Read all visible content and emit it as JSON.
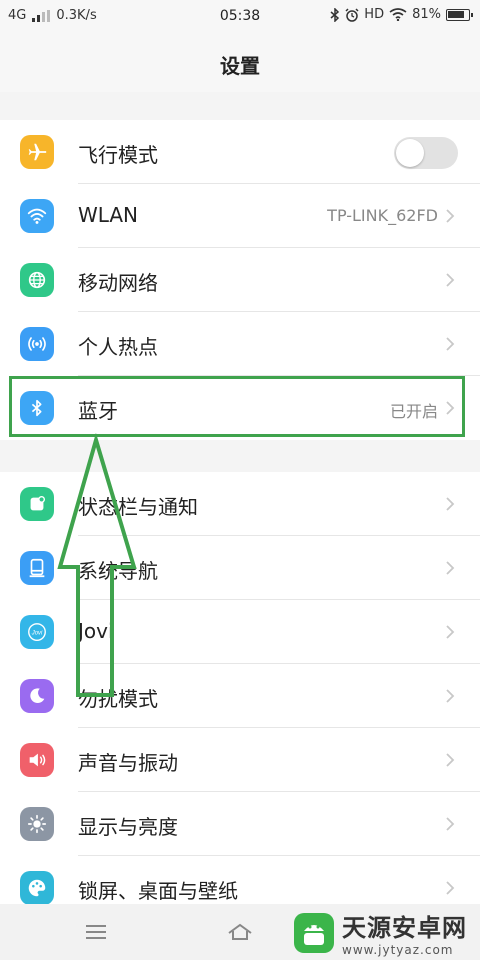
{
  "status_bar": {
    "network": "4G",
    "speed": "0.3K/s",
    "time": "05:38",
    "hd": "HD",
    "battery": "81%",
    "battery_level": 0.81
  },
  "header": {
    "title": "设置"
  },
  "group1": [
    {
      "label": "飞行模式",
      "icon": "airplane-icon",
      "color": "#f7b52a",
      "toggle": false
    },
    {
      "label": "WLAN",
      "value": "TP-LINK_62FD",
      "icon": "wifi-icon",
      "color": "#3da6f5"
    },
    {
      "label": "移动网络",
      "icon": "globe-icon",
      "color": "#2fc889"
    },
    {
      "label": "个人热点",
      "icon": "hotspot-icon",
      "color": "#3b9ef5"
    },
    {
      "label": "蓝牙",
      "value": "已开启",
      "icon": "bluetooth-icon",
      "color": "#3da6f5"
    }
  ],
  "group2": [
    {
      "label": "状态栏与通知",
      "icon": "notification-icon",
      "color": "#2fc889"
    },
    {
      "label": "系统导航",
      "icon": "navigation-icon",
      "color": "#3b9ef5"
    },
    {
      "label": "Jovi",
      "icon": "jovi-icon",
      "color": "#33b6e8",
      "icon_text": "Jovi"
    },
    {
      "label": "勿扰模式",
      "icon": "moon-icon",
      "color": "#9a6bf0"
    },
    {
      "label": "声音与振动",
      "icon": "speaker-icon",
      "color": "#f0606a"
    },
    {
      "label": "显示与亮度",
      "icon": "brightness-icon",
      "color": "#8c96a4"
    },
    {
      "label": "锁屏、桌面与壁纸",
      "icon": "palette-icon",
      "color": "#2fb7d8"
    }
  ],
  "watermark": {
    "name": "天源安卓网",
    "url": "www.jytyaz.com"
  },
  "colors": {
    "highlight": "#3fa34d",
    "background": "#f4f4f4"
  }
}
